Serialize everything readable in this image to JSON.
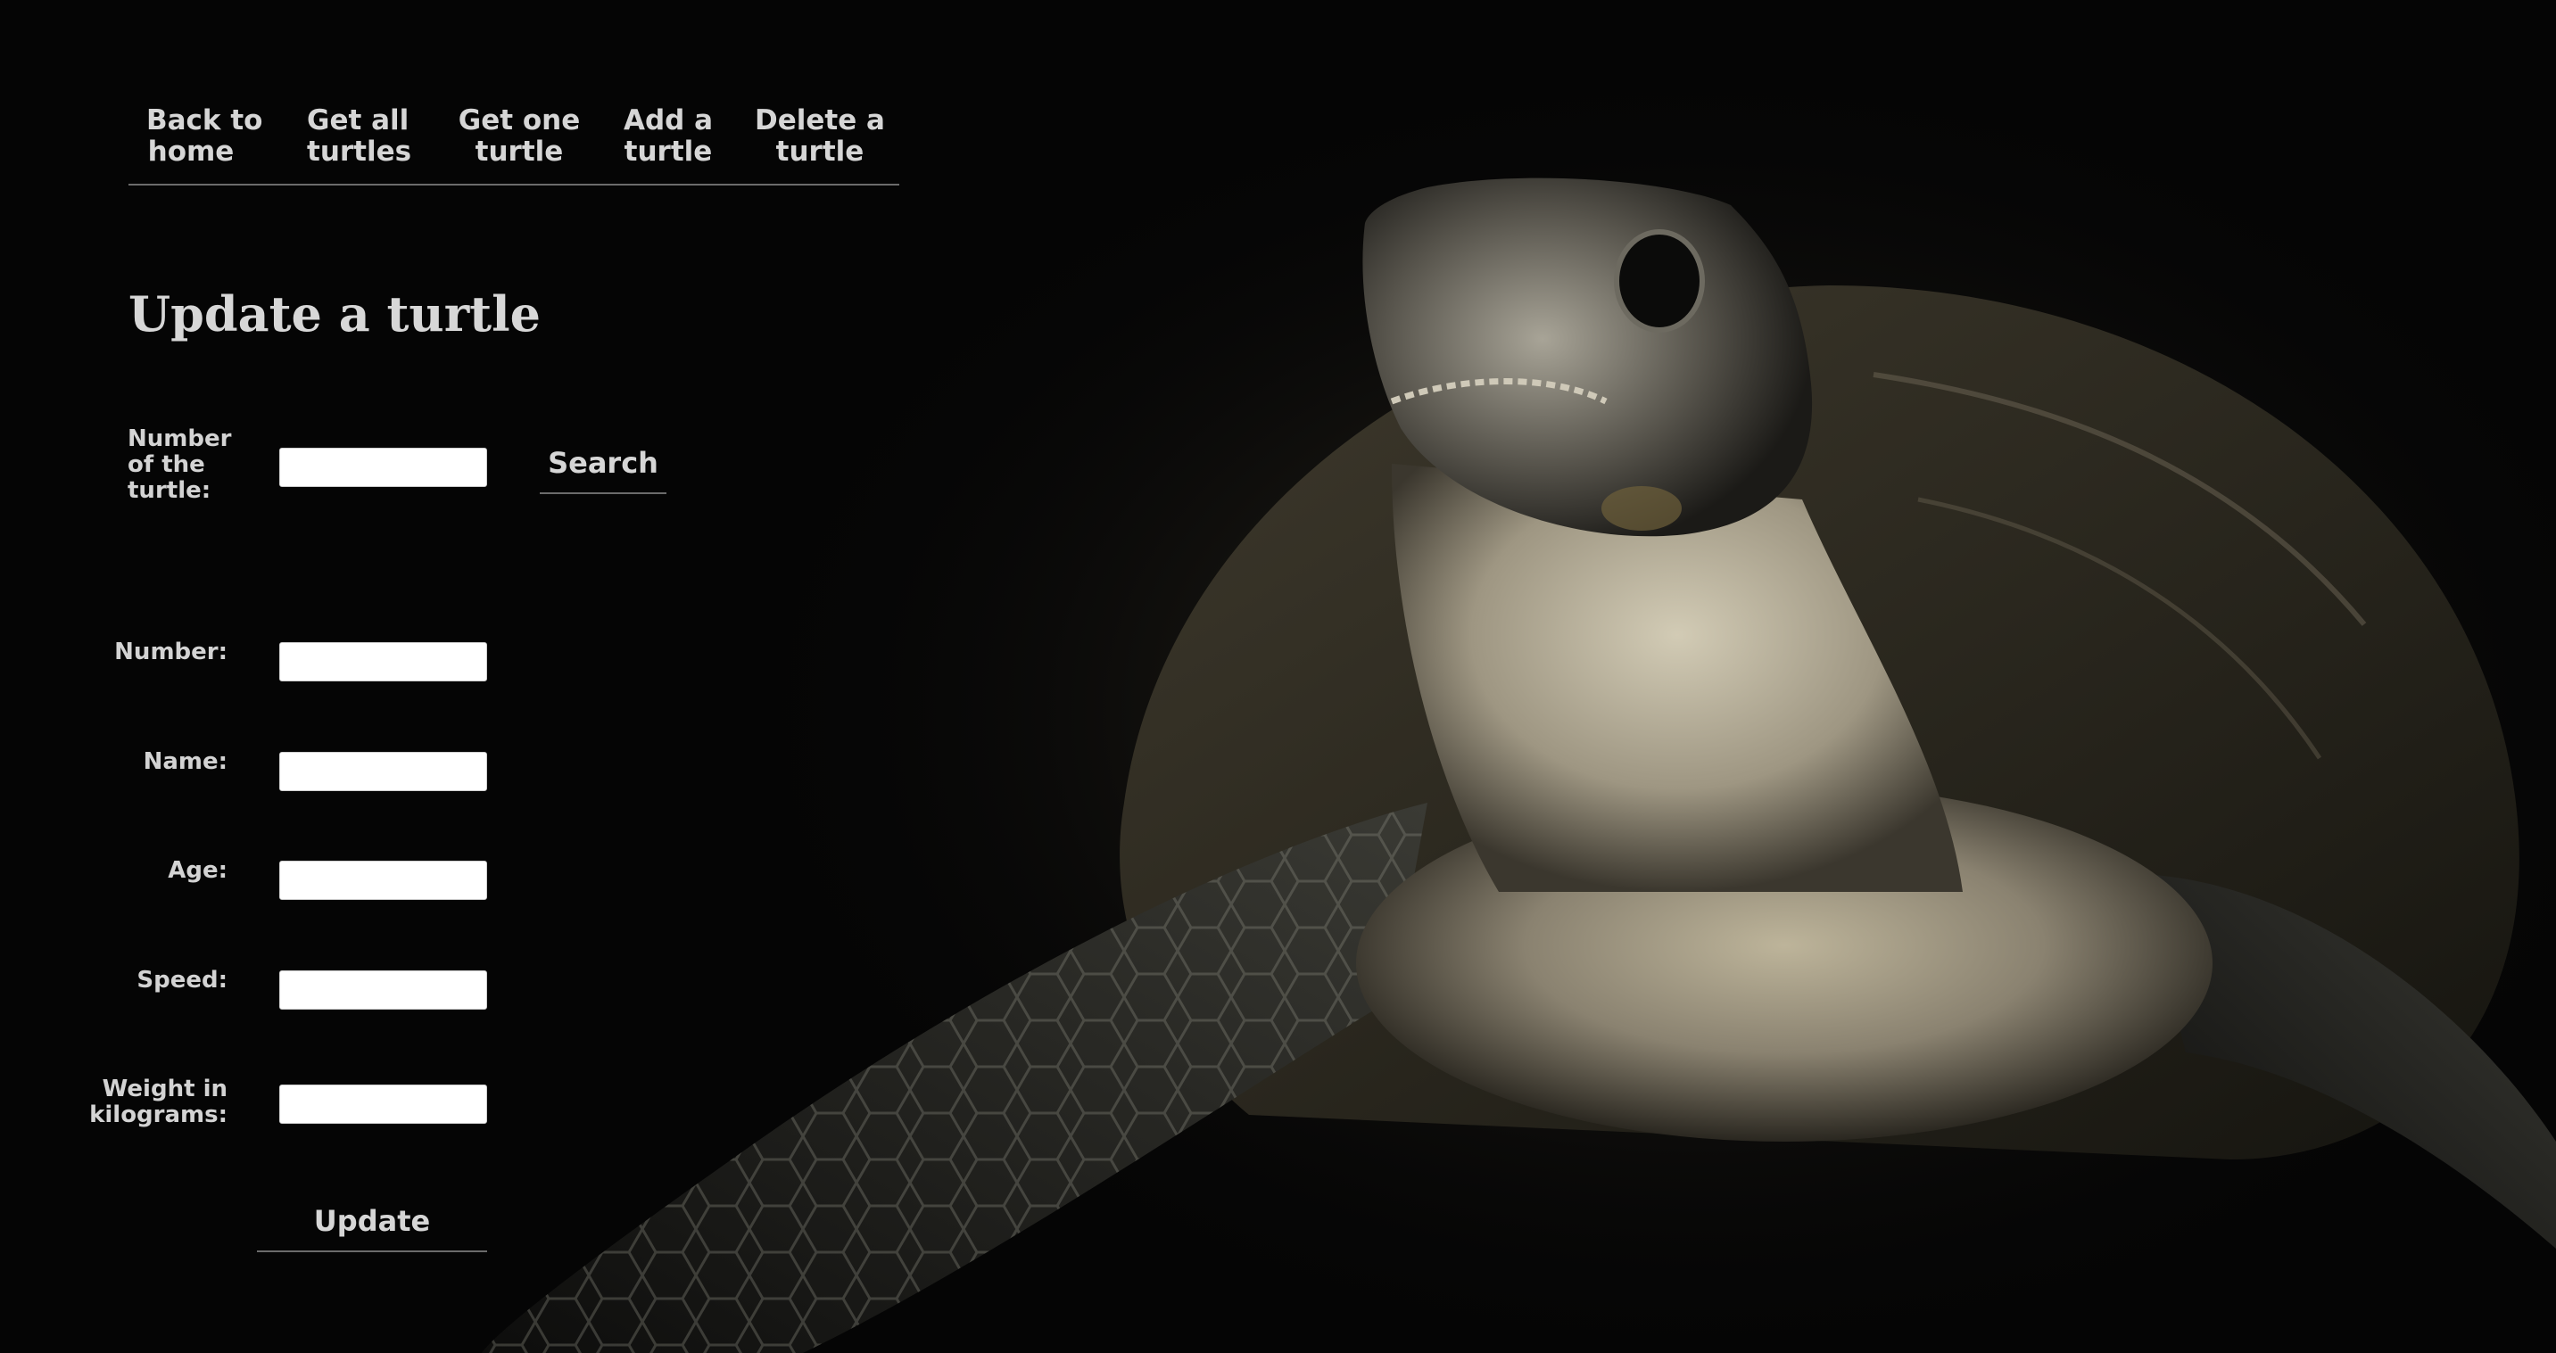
{
  "nav": {
    "items": [
      {
        "line1": "Back to",
        "line2": "home"
      },
      {
        "line1": "Get all",
        "line2": "turtles"
      },
      {
        "line1": "Get one",
        "line2": "turtle"
      },
      {
        "line1": "Add a",
        "line2": "turtle"
      },
      {
        "line1": "Delete a",
        "line2": "turtle"
      }
    ]
  },
  "page": {
    "title": "Update a turtle"
  },
  "search": {
    "label_line1": "Number",
    "label_line2": "of the",
    "label_line3": "turtle:",
    "value": "",
    "button_label": "Search"
  },
  "form": {
    "number_label": "Number:",
    "name_label": "Name:",
    "age_label": "Age:",
    "speed_label": "Speed:",
    "weight_label_line1": "Weight in",
    "weight_label_line2": "kilograms:",
    "number_value": "",
    "name_value": "",
    "age_value": "",
    "speed_value": "",
    "weight_value": "",
    "update_label": "Update"
  },
  "background": {
    "image": "sea-turtle-photo"
  }
}
